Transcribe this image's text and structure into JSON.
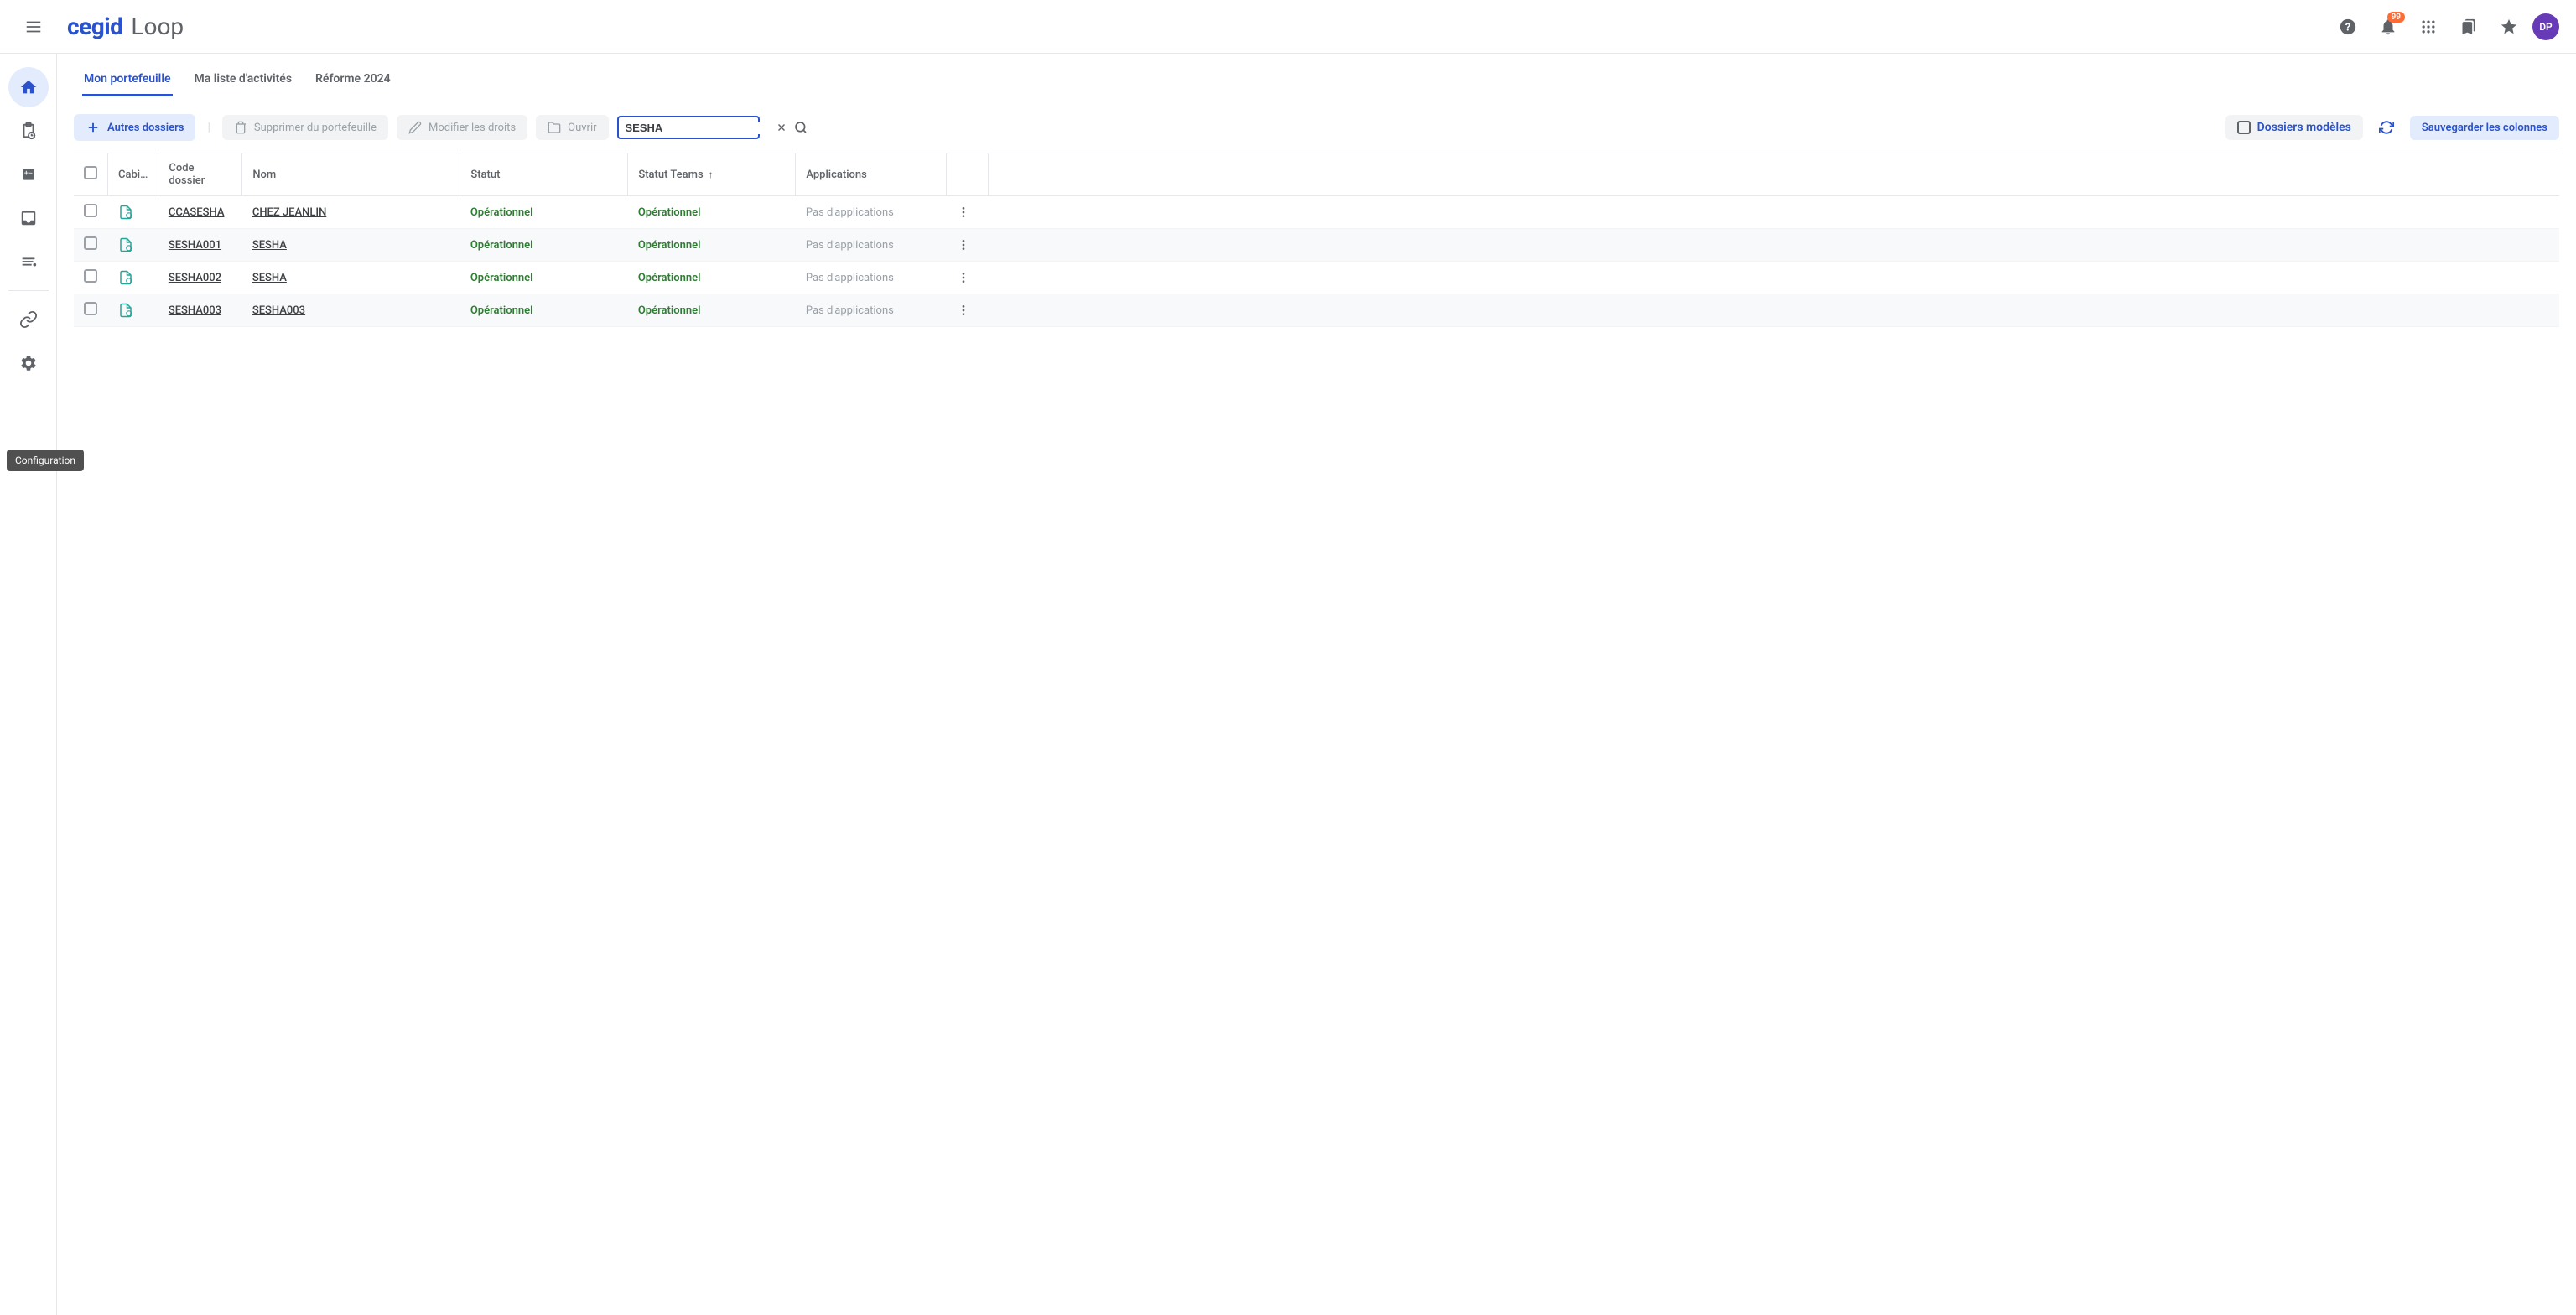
{
  "brand": {
    "cegid": "cegid",
    "loop": "Loop"
  },
  "header": {
    "notif_badge": "99",
    "avatar": "DP"
  },
  "sidebar": {
    "tooltip": "Configuration"
  },
  "tabs": [
    {
      "label": "Mon portefeuille",
      "active": true
    },
    {
      "label": "Ma liste d'activités",
      "active": false
    },
    {
      "label": "Réforme 2024",
      "active": false
    }
  ],
  "toolbar": {
    "autres": "Autres dossiers",
    "supprimer": "Supprimer du portefeuille",
    "modifier": "Modifier les droits",
    "ouvrir": "Ouvrir",
    "search_value": "SESHA",
    "dossiers_modeles": "Dossiers modèles",
    "sauvegarder": "Sauvegarder les colonnes"
  },
  "columns": {
    "cabi": "Cabi…",
    "code": "Code dossier",
    "nom": "Nom",
    "statut": "Statut",
    "statut_teams": "Statut Teams",
    "applications": "Applications"
  },
  "rows": [
    {
      "code": "CCASESHA",
      "nom": "CHEZ JEANLIN",
      "statut": "Opérationnel",
      "teams": "Opérationnel",
      "apps": "Pas d'applications"
    },
    {
      "code": "SESHA001",
      "nom": "SESHA",
      "statut": "Opérationnel",
      "teams": "Opérationnel",
      "apps": "Pas d'applications"
    },
    {
      "code": "SESHA002",
      "nom": "SESHA",
      "statut": "Opérationnel",
      "teams": "Opérationnel",
      "apps": "Pas d'applications"
    },
    {
      "code": "SESHA003",
      "nom": "SESHA003",
      "statut": "Opérationnel",
      "teams": "Opérationnel",
      "apps": "Pas d'applications"
    }
  ]
}
